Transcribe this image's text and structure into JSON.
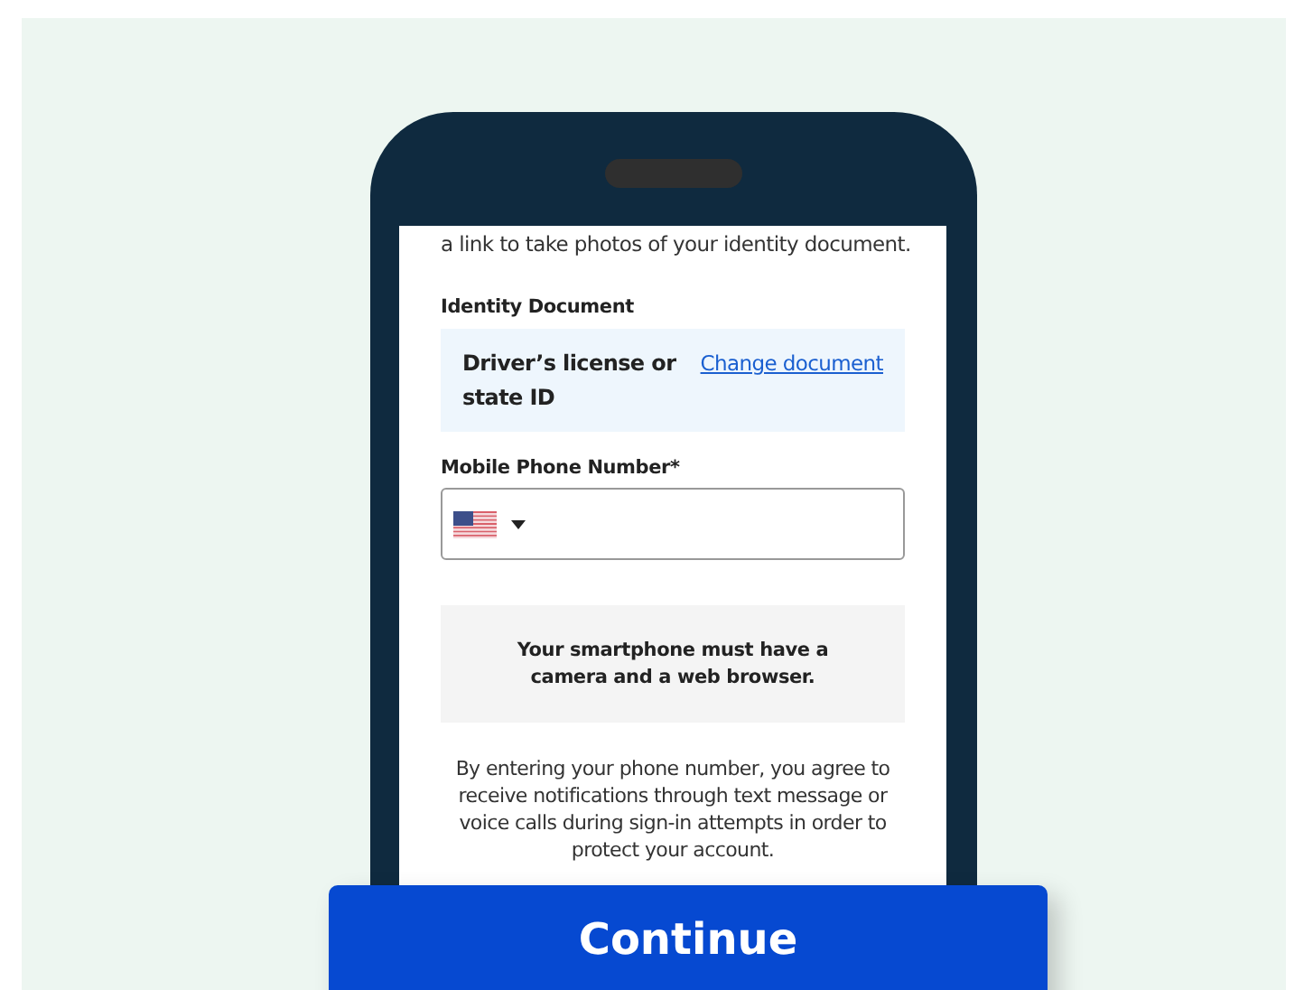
{
  "intro": "a link to take photos of your identity document.",
  "identity_document": {
    "label": "Identity Document",
    "value": "Driver’s license or state ID",
    "link": "Change document"
  },
  "phone": {
    "label": "Mobile Phone Number*"
  },
  "notice": "Your smartphone must have a camera and a web browser.",
  "consent": "By entering your phone number, you agree to receive notifications through text message or voice calls during sign-in attempts in order to protect your account.",
  "continue_button": "Continue"
}
